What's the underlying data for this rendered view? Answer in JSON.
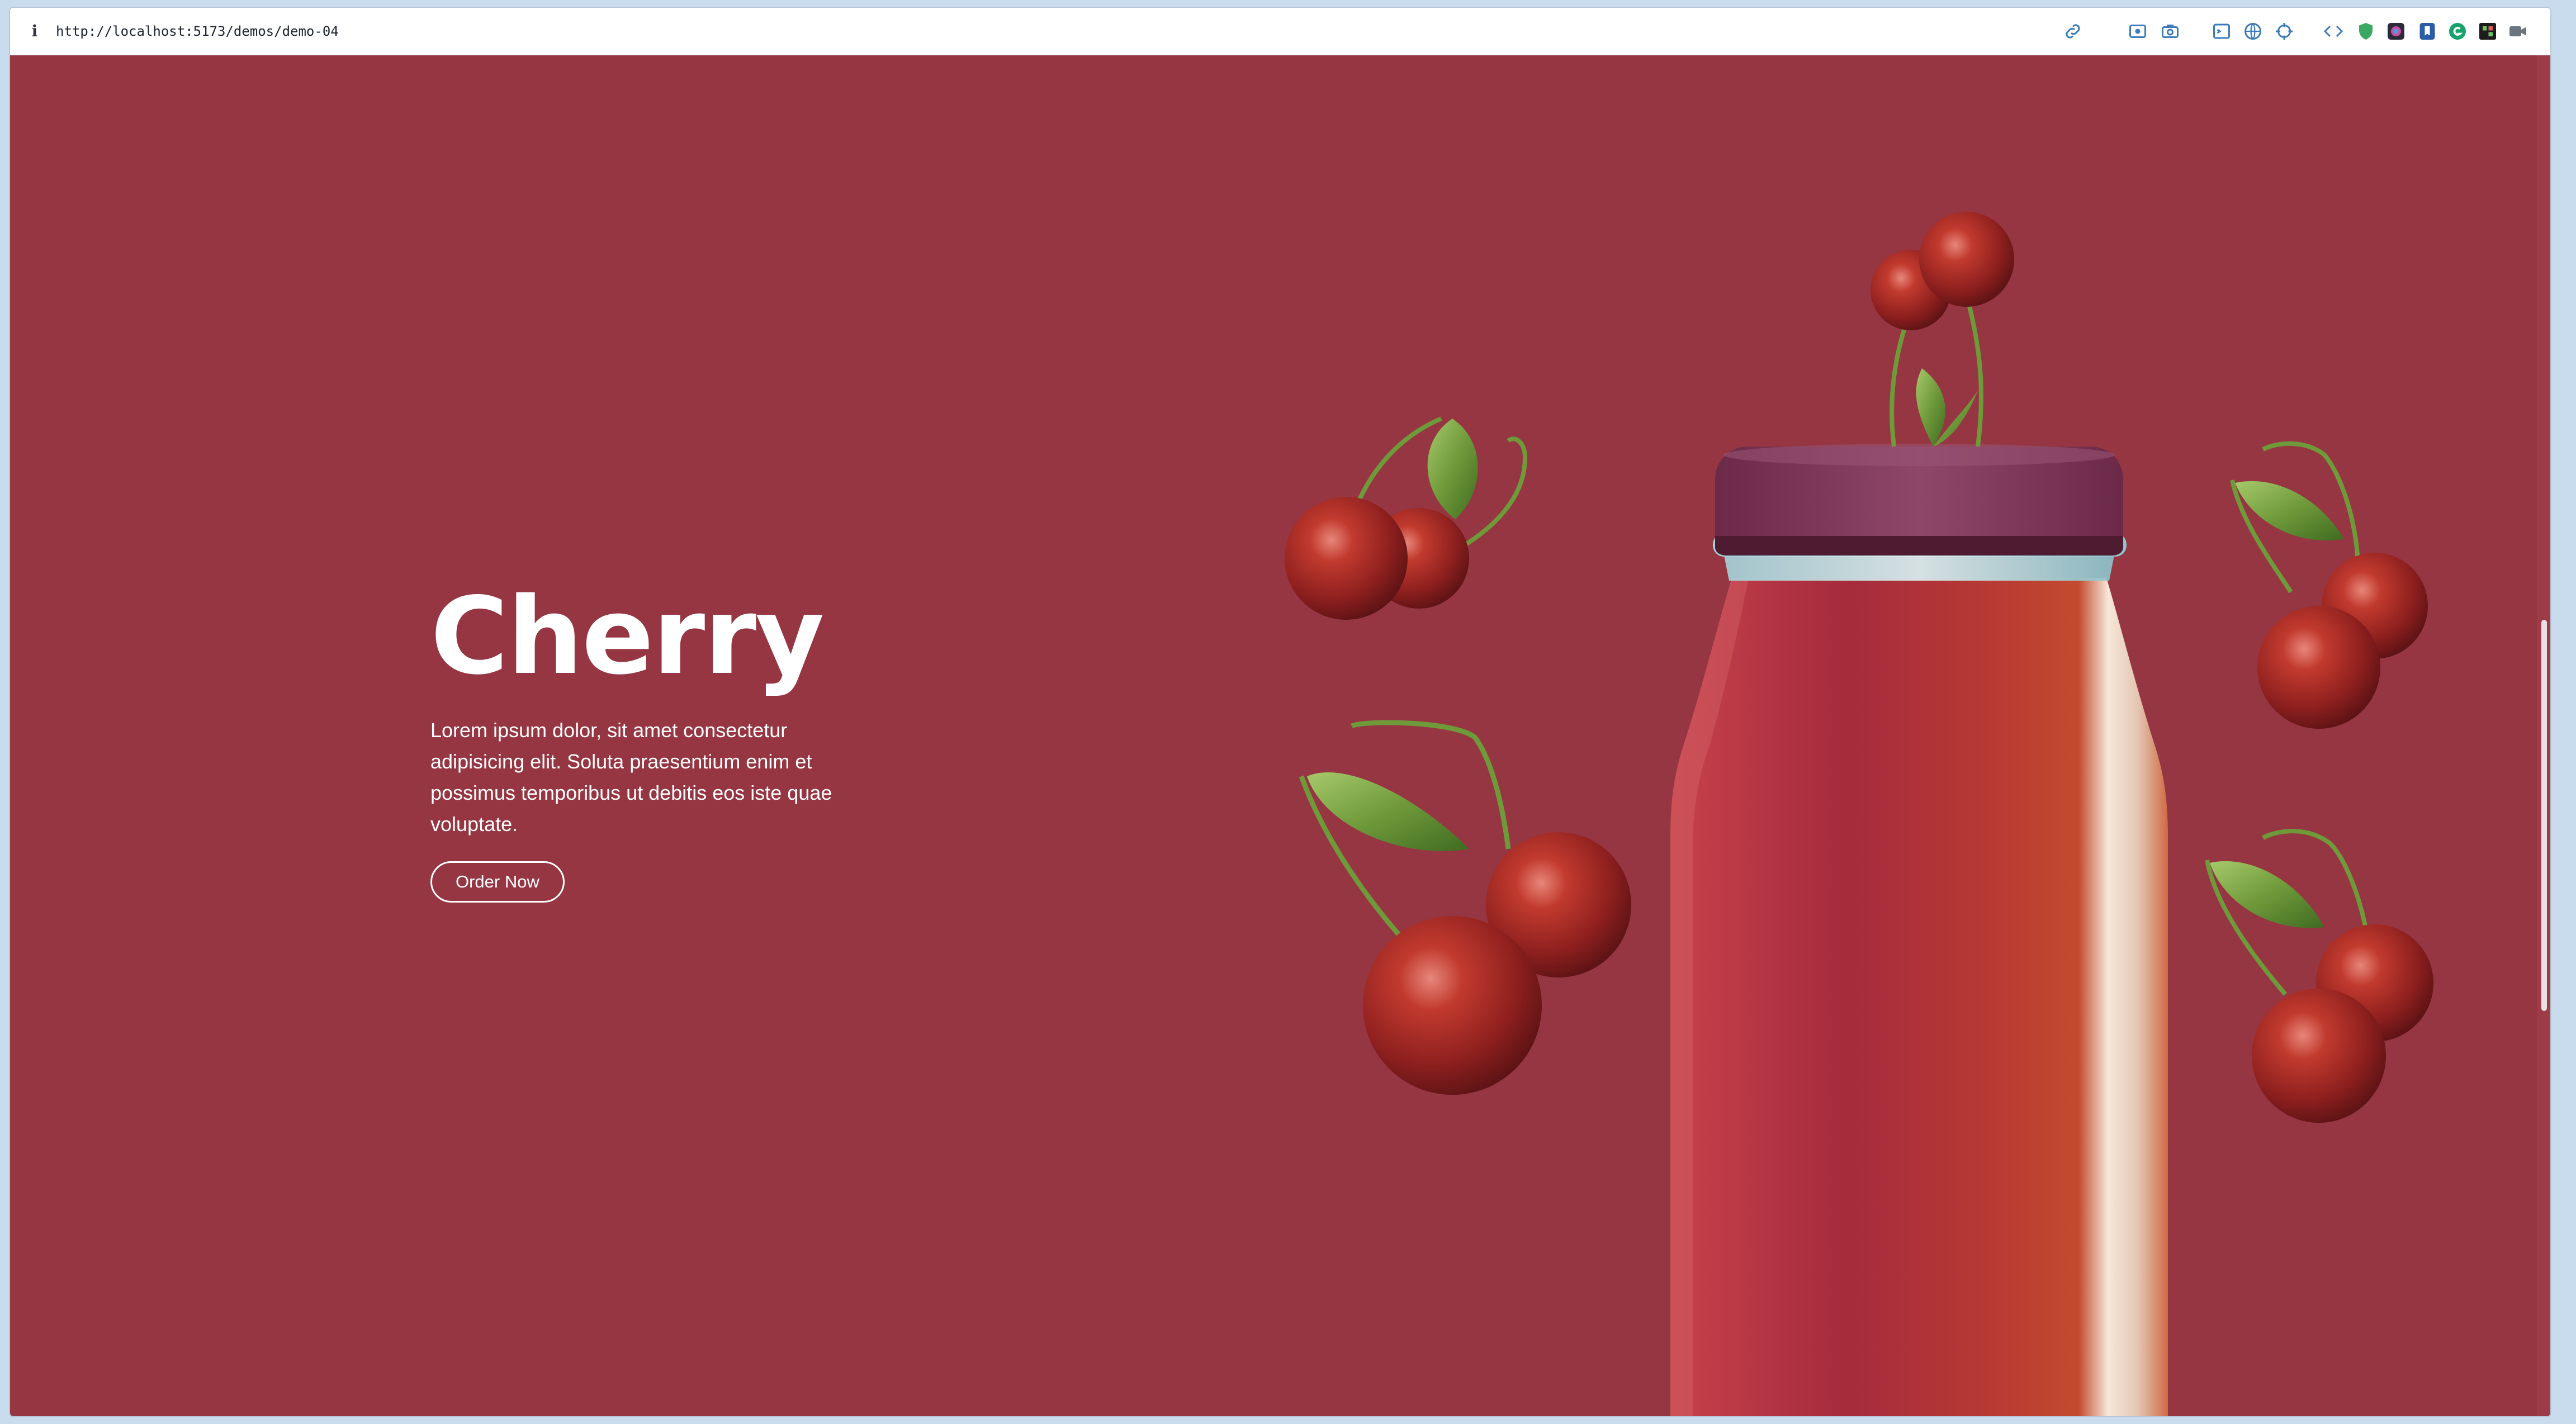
{
  "browser": {
    "url": "http://localhost:5173/demos/demo-04",
    "icons": [
      "info-icon",
      "link-icon",
      "screen-capture-icon",
      "camera-icon",
      "terminal-icon",
      "globe-icon",
      "crosshair-icon",
      "devtools-icon",
      "shield-icon",
      "color-icon",
      "bookmark-icon",
      "grammar-icon",
      "puzzle-icon",
      "video-icon",
      "sidebar-icon"
    ]
  },
  "hero": {
    "title": "Cherry",
    "description": "Lorem ipsum dolor, sit amet consectetur adipisicing elit. Soluta praesentium enim et possimus temporibus ut debitis eos iste quae voluptate.",
    "button_label": "Order Now"
  },
  "colors": {
    "background": "#953642",
    "bottle_cap": "#7a3450",
    "juice": "#b5343f",
    "text": "#ffffff"
  }
}
